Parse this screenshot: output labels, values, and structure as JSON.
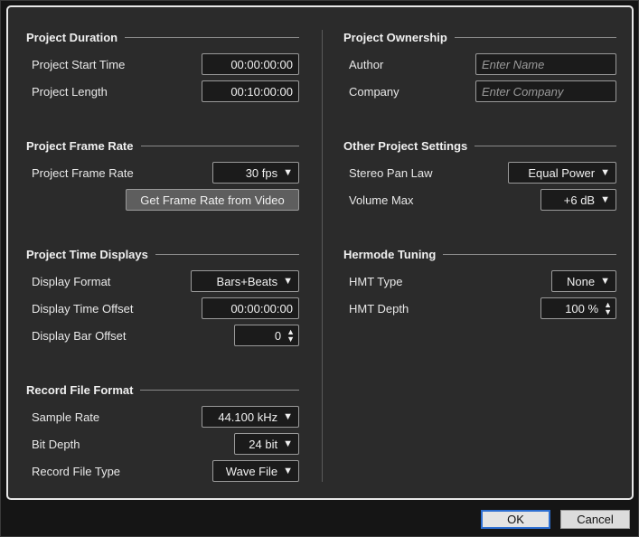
{
  "sections": {
    "duration": {
      "title": "Project Duration",
      "start_time_label": "Project Start Time",
      "start_time_value": "00:00:00:00",
      "length_label": "Project Length",
      "length_value": "00:10:00:00"
    },
    "frame_rate": {
      "title": "Project Frame Rate",
      "rate_label": "Project Frame Rate",
      "rate_value": "30 fps",
      "get_from_video_label": "Get Frame Rate from Video"
    },
    "time_displays": {
      "title": "Project Time Displays",
      "format_label": "Display Format",
      "format_value": "Bars+Beats",
      "time_offset_label": "Display Time Offset",
      "time_offset_value": "00:00:00:00",
      "bar_offset_label": "Display Bar Offset",
      "bar_offset_value": "0"
    },
    "record_format": {
      "title": "Record File Format",
      "sample_rate_label": "Sample Rate",
      "sample_rate_value": "44.100 kHz",
      "bit_depth_label": "Bit Depth",
      "bit_depth_value": "24 bit",
      "file_type_label": "Record File Type",
      "file_type_value": "Wave File"
    },
    "ownership": {
      "title": "Project Ownership",
      "author_label": "Author",
      "author_placeholder": "Enter Name",
      "company_label": "Company",
      "company_placeholder": "Enter Company"
    },
    "other": {
      "title": "Other Project Settings",
      "pan_law_label": "Stereo Pan Law",
      "pan_law_value": "Equal Power",
      "volume_max_label": "Volume Max",
      "volume_max_value": "+6 dB"
    },
    "hermode": {
      "title": "Hermode Tuning",
      "hmt_type_label": "HMT Type",
      "hmt_type_value": "None",
      "hmt_depth_label": "HMT Depth",
      "hmt_depth_value": "100 %"
    }
  },
  "footer": {
    "ok_label": "OK",
    "cancel_label": "Cancel"
  },
  "icons": {
    "dropdown": "▼",
    "spin_up": "▲",
    "spin_down": "▼"
  }
}
